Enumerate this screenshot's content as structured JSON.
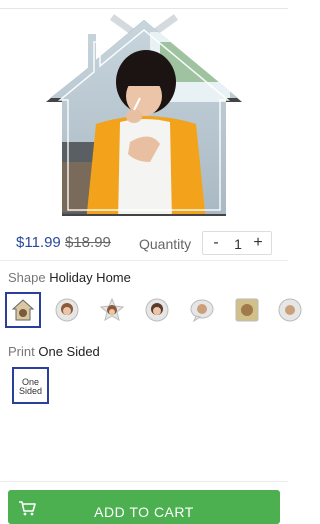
{
  "product": {
    "image_icon": "house-shaped-photo"
  },
  "pricing": {
    "sale_price": "$11.99",
    "original_price": "$18.99"
  },
  "quantity": {
    "label": "Quantity",
    "minus": "-",
    "value": "1",
    "plus": "+"
  },
  "shape": {
    "label": "Shape",
    "selected": "Holiday Home",
    "options": [
      {
        "icon": "house-thumbnail"
      },
      {
        "icon": "round-thumbnail"
      },
      {
        "icon": "star-thumbnail"
      },
      {
        "icon": "badge-thumbnail"
      },
      {
        "icon": "bubble-thumbnail"
      },
      {
        "icon": "square-thumbnail"
      },
      {
        "icon": "round-thumbnail"
      }
    ]
  },
  "print": {
    "label": "Print",
    "selected": "One Sided",
    "option_line1": "One",
    "option_line2": "Sided"
  },
  "cart": {
    "label": "ADD TO CART",
    "icon": "cart-icon"
  },
  "colors": {
    "accent": "#2a3f9a",
    "price": "#274a9a",
    "cart_button": "#4caf50"
  }
}
